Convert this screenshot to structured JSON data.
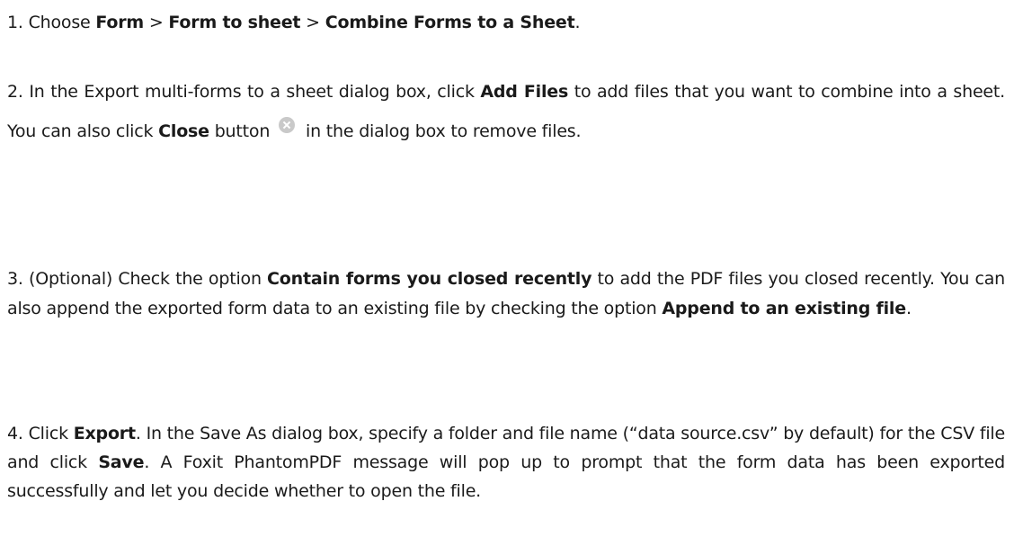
{
  "steps": [
    {
      "number": "1.",
      "parts": [
        "Choose ",
        "Form",
        " > ",
        "Form to sheet",
        " > ",
        "Combine Forms to a Sheet",
        "."
      ]
    },
    {
      "number": "2.",
      "parts": [
        "In the Export multi-forms to a sheet dialog box, click ",
        "Add Files",
        " to add files that you want to combine into a sheet. You can also click ",
        "Close",
        " button",
        " in the dialog box to remove files."
      ],
      "icon": "close-circle-icon"
    },
    {
      "number": "3.",
      "parts": [
        "(Optional) Check the option ",
        "Contain forms you closed recently",
        " to add the PDF files you closed recently. You can also append the exported form data to an existing file by checking the option ",
        "Append to an existing file",
        "."
      ]
    },
    {
      "number": "4.",
      "parts": [
        "Click ",
        "Export",
        ". In the Save As dialog box, specify a folder and file name (“data source.csv” by default) for the CSV file and click ",
        "Save",
        ". A Foxit PhantomPDF message will pop up to prompt that the form data has been exported successfully and let you decide whether to open the file."
      ]
    }
  ]
}
